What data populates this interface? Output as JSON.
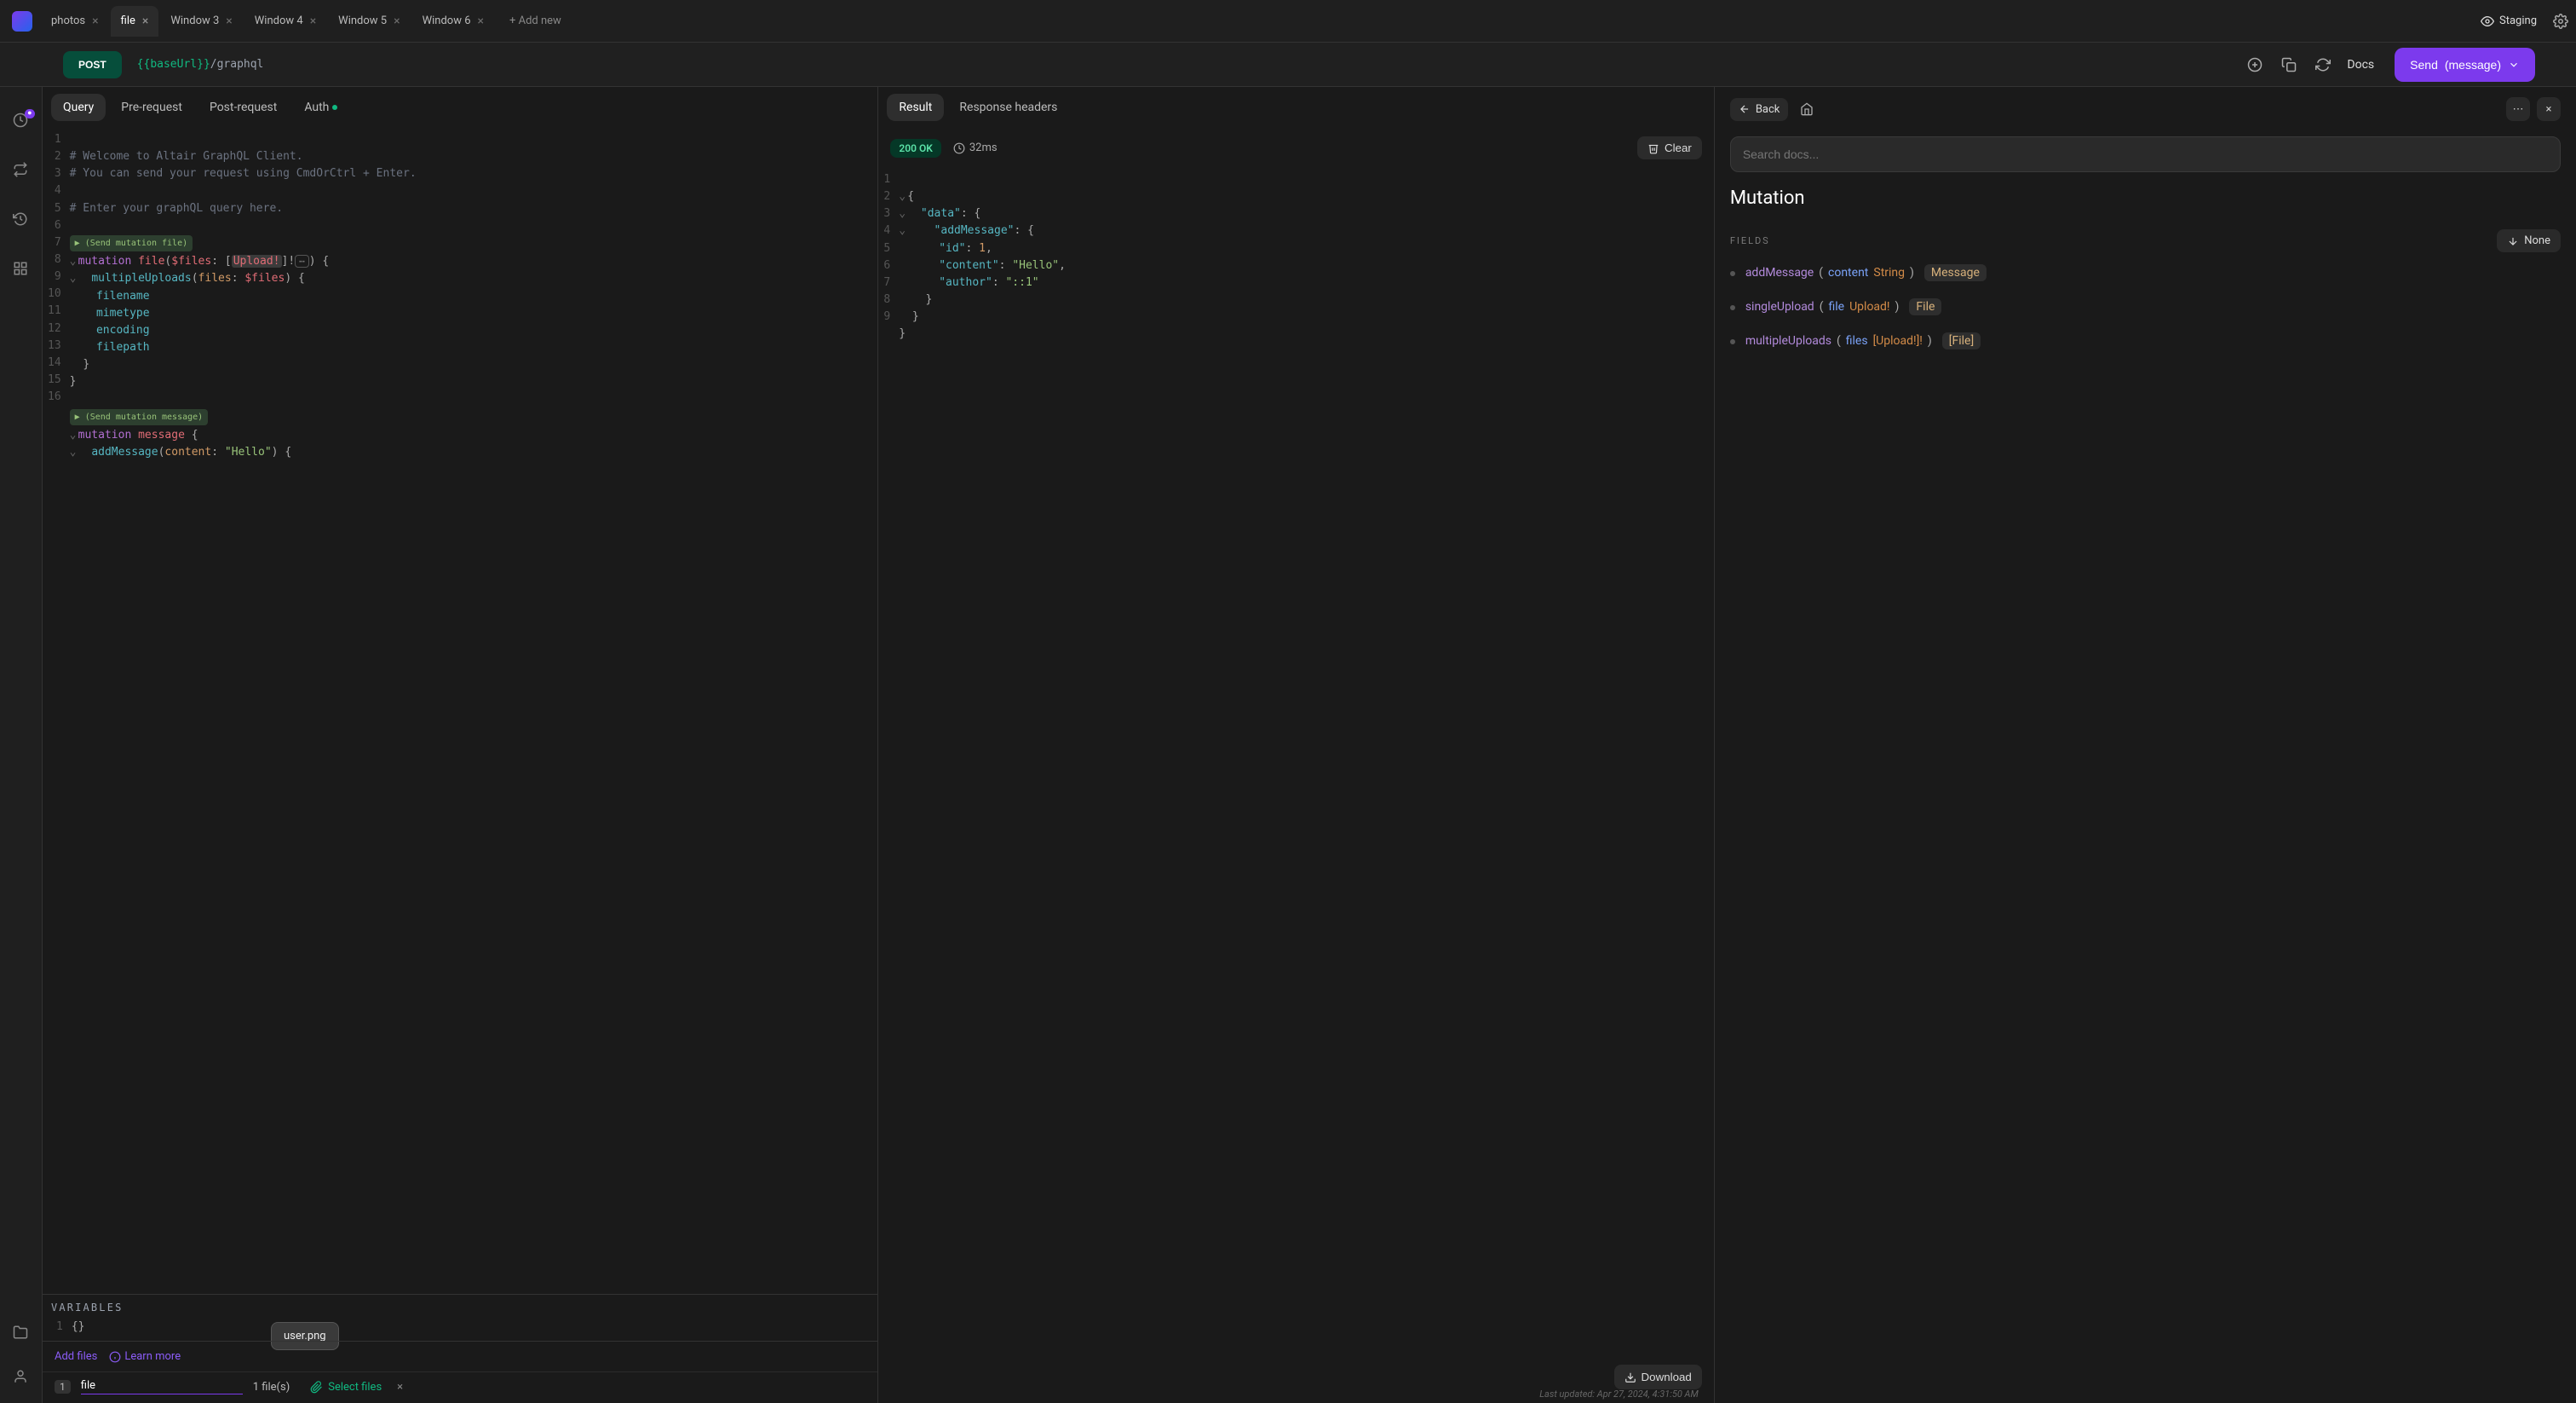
{
  "tabs": [
    {
      "label": "photos"
    },
    {
      "label": "file",
      "active": true
    },
    {
      "label": "Window 3"
    },
    {
      "label": "Window 4"
    },
    {
      "label": "Window 5"
    },
    {
      "label": "Window 6"
    }
  ],
  "add_tab": "+ Add new",
  "env_label": "Staging",
  "action_bar": {
    "method": "POST",
    "url_var": "{{baseUrl}}",
    "url_path": "/graphql",
    "docs": "Docs",
    "send": "Send",
    "send_op": "(message)"
  },
  "query_tabs": {
    "query": "Query",
    "pre": "Pre-request",
    "post": "Post-request",
    "auth": "Auth"
  },
  "editor": {
    "line1": "# Welcome to Altair GraphQL Client.",
    "line2": "# You can send your request using CmdOrCtrl + Enter.",
    "line4": "# Enter your graphQL query here.",
    "chip_file": "▶ (Send mutation file)",
    "mutation_kw": "mutation",
    "file_name": "file",
    "files_var": "$files",
    "upload_type": "Upload!",
    "multipleUploads": "multipleUploads",
    "files_arg": "files",
    "f1": "filename",
    "f2": "mimetype",
    "f3": "encoding",
    "f4": "filepath",
    "chip_msg": "▶ (Send mutation message)",
    "message_name": "message",
    "addMessage": "addMessage",
    "content_arg": "content",
    "hello_str": "\"Hello\""
  },
  "variables": {
    "title": "VARIABLES",
    "body": "{}"
  },
  "files_bar": {
    "add": "Add files",
    "learn": "Learn more",
    "popup": "user.png",
    "index": "1",
    "var": "file",
    "count": "1 file(s)",
    "select": "Select files"
  },
  "result_tabs": {
    "result": "Result",
    "headers": "Response headers"
  },
  "result": {
    "status": "200 OK",
    "time": "32ms",
    "clear": "Clear",
    "json": {
      "data": "\"data\"",
      "addMessage": "\"addMessage\"",
      "id_k": "\"id\"",
      "id_v": "1",
      "content_k": "\"content\"",
      "content_v": "\"Hello\"",
      "author_k": "\"author\"",
      "author_v": "\"::1\""
    },
    "download": "Download",
    "updated": "Last updated: Apr 27, 2024, 4:31:50 AM"
  },
  "docs": {
    "back": "Back",
    "search_ph": "Search docs...",
    "title": "Mutation",
    "fields_label": "FIELDS",
    "none": "None",
    "f1": {
      "name": "addMessage",
      "arg": "content",
      "argtype": "String",
      "ret": "Message"
    },
    "f2": {
      "name": "singleUpload",
      "arg": "file",
      "argtype": "Upload!",
      "ret": "File"
    },
    "f3": {
      "name": "multipleUploads",
      "arg": "files",
      "argtype": "[Upload!]!",
      "ret": "[File]"
    }
  }
}
